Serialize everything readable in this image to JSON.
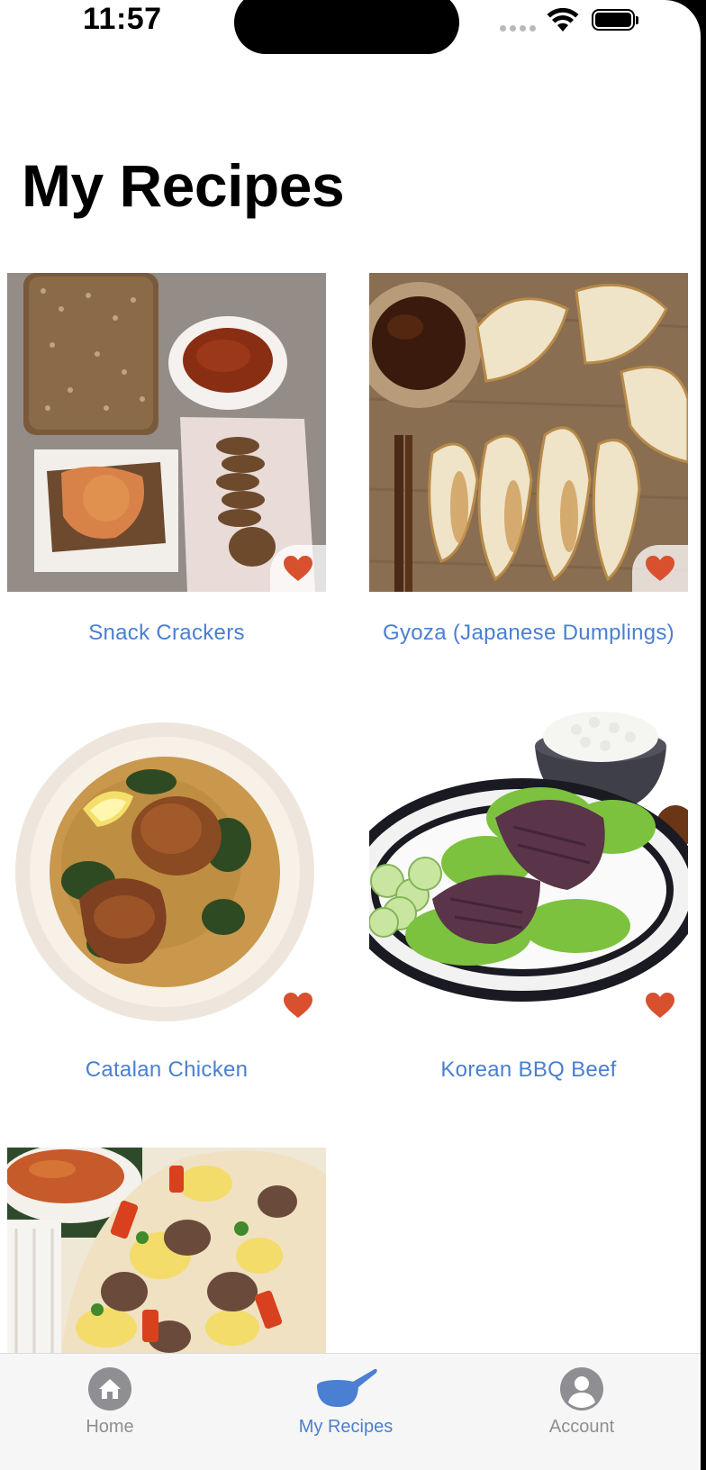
{
  "status_bar": {
    "time": "11:57"
  },
  "page": {
    "title": "My Recipes"
  },
  "recipes": [
    {
      "name": "Snack Crackers",
      "favorite": true
    },
    {
      "name": "Gyoza (Japanese Dumplings)",
      "favorite": true
    },
    {
      "name": "Catalan Chicken",
      "favorite": true
    },
    {
      "name": "Korean BBQ Beef",
      "favorite": true
    },
    {
      "name": "",
      "favorite": false
    }
  ],
  "tab_bar": {
    "items": [
      {
        "label": "Home",
        "icon": "house-icon",
        "active": false
      },
      {
        "label": "My Recipes",
        "icon": "pan-icon",
        "active": true
      },
      {
        "label": "Account",
        "icon": "person-icon",
        "active": false
      }
    ]
  },
  "colors": {
    "accent": "#4a7fd1",
    "heart": "#d9502e",
    "tab_inactive": "#8e8e93"
  }
}
